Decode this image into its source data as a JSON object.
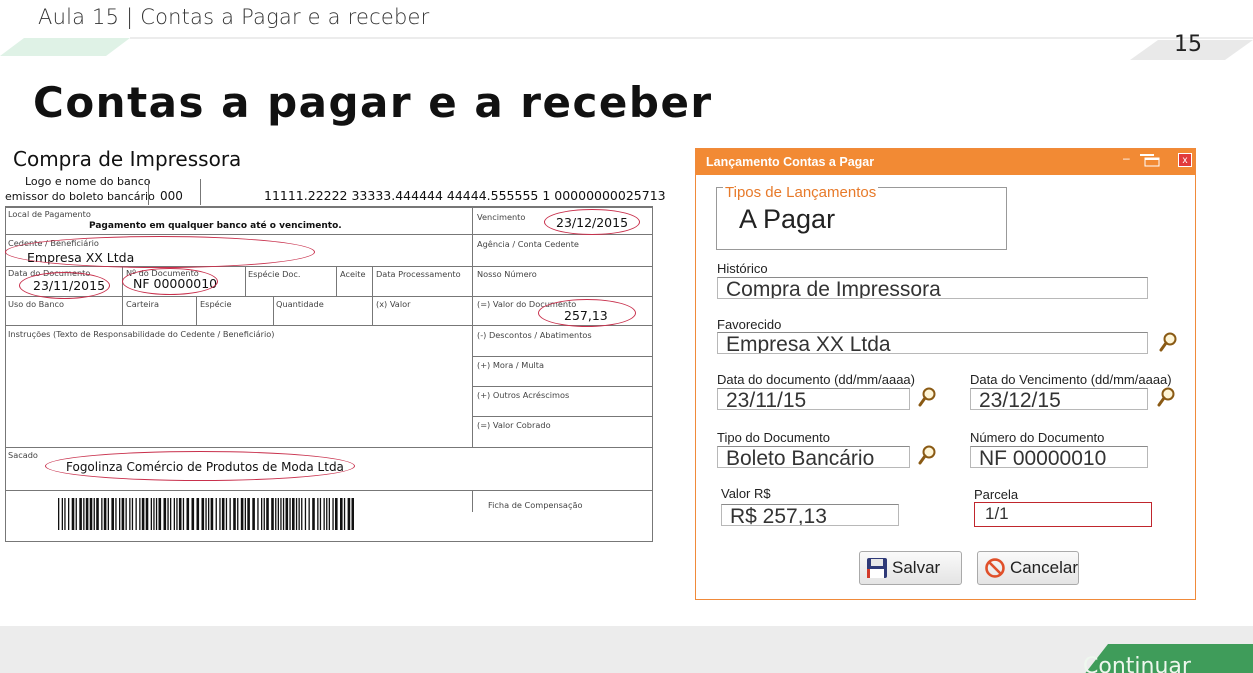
{
  "header": {
    "lesson_title": "Aula 15 | Contas a Pagar e a receber",
    "page_number": "15",
    "page_title": "Contas a pagar e a receber"
  },
  "boleto": {
    "caption": "Compra de Impressora",
    "logo_label_line1": "Logo e nome do banco",
    "logo_label_line2": "emissor do boleto bancário",
    "bank_code": "000",
    "digitable_line": "11111.22222 33333.444444 44444.555555 1 00000000025713",
    "local_pagamento_label": "Local de Pagamento",
    "local_pagamento_value": "Pagamento em qualquer banco até o vencimento.",
    "vencimento_label": "Vencimento",
    "vencimento_value": "23/12/2015",
    "cedente_label": "Cedente / Beneficiário",
    "cedente_value": "Empresa XX Ltda",
    "agencia_label": "Agência / Conta Cedente",
    "data_documento_label": "Data do Documento",
    "data_documento_value": "23/11/2015",
    "num_documento_label": "Nº do Documento",
    "num_documento_value": "NF 00000010",
    "especie_doc_label": "Espécie Doc.",
    "aceite_label": "Aceite",
    "data_processamento_label": "Data Processamento",
    "nosso_numero_label": "Nosso Número",
    "uso_banco_label": "Uso do Banco",
    "carteira_label": "Carteira",
    "especie_label": "Espécie",
    "quantidade_label": "Quantidade",
    "x_valor_label": "(x) Valor",
    "valor_documento_label": "(=) Valor do Documento",
    "valor_documento_value": "257,13",
    "instrucoes_label": "Instruções (Texto de Responsabilidade do Cedente / Beneficiário)",
    "descontos_label": "(-) Descontos / Abatimentos",
    "mora_label": "(+) Mora / Multa",
    "outros_label": "(+) Outros Acréscimos",
    "valor_cobrado_label": "(=) Valor Cobrado",
    "sacado_label": "Sacado",
    "sacado_value": "Fogolinza Comércio de Produtos de Moda Ltda",
    "ficha_label": "Ficha de Compensação"
  },
  "dialog": {
    "title": "Lançamento Contas a Pagar",
    "group_legend": "Tipos de Lançamentos",
    "group_value": "A Pagar",
    "historico_label": "Histórico",
    "historico_value": "Compra de Impressora",
    "favorecido_label": "Favorecido",
    "favorecido_value": "Empresa XX Ltda",
    "data_doc_label": "Data do documento (dd/mm/aaaa)",
    "data_doc_value": "23/11/15",
    "data_venc_label": "Data do Vencimento (dd/mm/aaaa)",
    "data_venc_value": "23/12/15",
    "tipo_doc_label": "Tipo do Documento",
    "tipo_doc_value": "Boleto Bancário",
    "num_doc_label": "Número do Documento",
    "num_doc_value": "NF 00000010",
    "valor_label": "Valor R$",
    "valor_value": "R$ 257,13",
    "parcela_label": "Parcela",
    "parcela_value": "1/1",
    "save_label": "Salvar",
    "cancel_label": "Cancelar",
    "accent_color": "#f28a34",
    "close_color": "#e23b3b"
  },
  "footer": {
    "continue_label": "Continuar"
  }
}
